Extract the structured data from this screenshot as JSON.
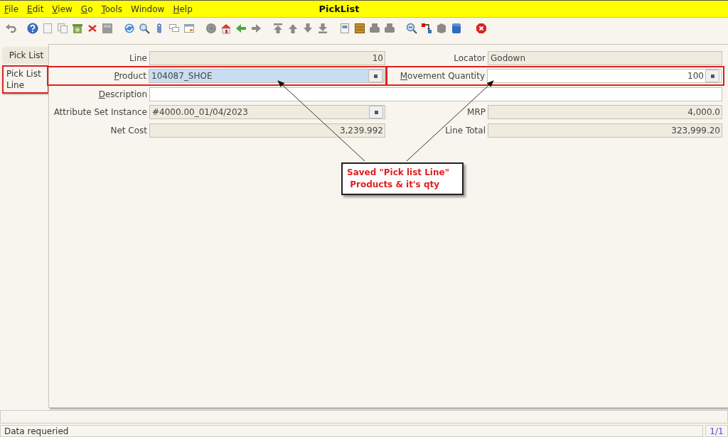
{
  "window": {
    "title": "PickList"
  },
  "menu": [
    {
      "label": "File",
      "mnemonic": true
    },
    {
      "label": "Edit",
      "mnemonic": true
    },
    {
      "label": "View",
      "mnemonic": true
    },
    {
      "label": "Go",
      "mnemonic": true
    },
    {
      "label": "Tools",
      "mnemonic": true
    },
    {
      "label": "Window",
      "mnemonic": false
    },
    {
      "label": "Help",
      "mnemonic": true
    }
  ],
  "tabs": [
    {
      "label": "Pick List",
      "selected": false,
      "highlighted": false
    },
    {
      "label": "Pick List Line",
      "selected": true,
      "highlighted": true
    }
  ],
  "form": {
    "rows": [
      {
        "fields": [
          {
            "label": "Line",
            "mnemonic": false,
            "value": "10",
            "readonly": true,
            "focused": false,
            "kind": "number",
            "has_button": false,
            "highlighted": false
          },
          {
            "label": "Locator",
            "mnemonic": false,
            "value": "Godown",
            "readonly": true,
            "focused": false,
            "kind": "text",
            "has_button": false,
            "highlighted": false
          }
        ]
      },
      {
        "fields": [
          {
            "label": "Product",
            "mnemonic": true,
            "value": "104087_SHOE",
            "readonly": false,
            "focused": true,
            "kind": "text",
            "has_button": true,
            "highlighted": true
          },
          {
            "label": "Movement Quantity",
            "mnemonic": true,
            "value": "100",
            "readonly": false,
            "focused": false,
            "kind": "number",
            "has_button": true,
            "highlighted": true
          }
        ]
      },
      {
        "fields": [
          {
            "label": "Description",
            "mnemonic": true,
            "readonly": false,
            "focused": false,
            "kind": "text",
            "has_button": false,
            "highlighted": false,
            "wide": true
          }
        ]
      },
      {
        "fields": [
          {
            "label": "Attribute Set Instance",
            "mnemonic": false,
            "value": "#4000.00_01/04/2023",
            "readonly": true,
            "focused": false,
            "kind": "text",
            "has_button": true,
            "highlighted": false
          },
          {
            "label": "MRP",
            "mnemonic": false,
            "value": "4,000.0",
            "readonly": true,
            "focused": false,
            "kind": "number",
            "has_button": false,
            "highlighted": false
          }
        ]
      },
      {
        "fields": [
          {
            "label": "Net Cost",
            "mnemonic": false,
            "value": "3,239.992",
            "readonly": true,
            "focused": false,
            "kind": "number",
            "has_button": false,
            "highlighted": false
          },
          {
            "label": "Line Total",
            "mnemonic": false,
            "value": "323,999.20",
            "readonly": true,
            "focused": false,
            "kind": "number",
            "has_button": false,
            "highlighted": false
          }
        ]
      }
    ]
  },
  "callout": {
    "lines": [
      "Saved \"Pick list Line\"",
      "Products & it's qty"
    ]
  },
  "status_bar": {
    "message": "Data requeried",
    "record": "1/1"
  }
}
